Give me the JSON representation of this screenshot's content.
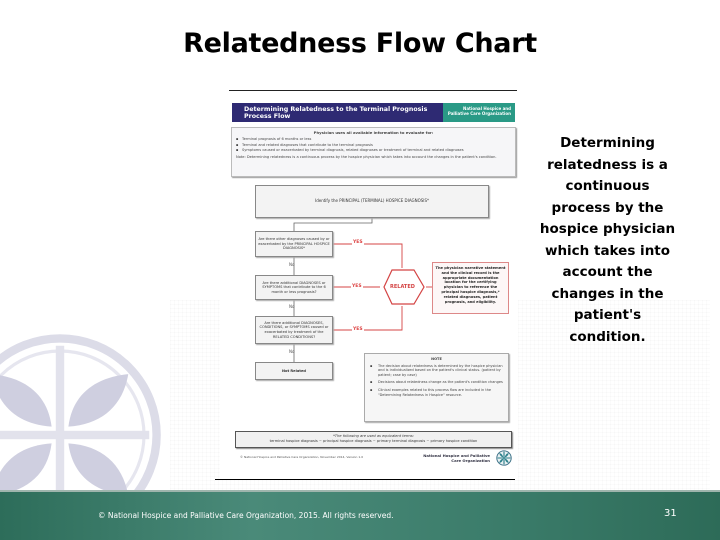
{
  "slide": {
    "title": "Relatedness Flow Chart",
    "side_text": "Determining relatedness is a continuous process by the hospice physician which takes into account the changes in the patient's condition.",
    "page_number": "31",
    "footer_copyright": "© National Hospice and Palliative Care Organization, 2015. All rights reserved."
  },
  "flowchart": {
    "header_title": "Determining Relatedness to the Terminal Prognosis Process Flow",
    "header_org": "National Hospice and Palliative Care Organization",
    "info": {
      "heading": "Physician uses all available information to evaluate for:",
      "items": [
        "Terminal prognosis of 6 months or less",
        "Terminal and related diagnoses that contribute to the terminal prognosis",
        "Symptoms caused or exacerbated by terminal diagnosis, related diagnoses or treatment of terminal and related diagnoses"
      ],
      "note": "Note: Determining relatedness is a continuous process by the hospice physician which takes into account the changes in the patient's condition."
    },
    "principal_step": "Identify the PRINCIPAL (TERMINAL) HOSPICE DIAGNOSIS*",
    "questions": [
      "Are there other diagnoses caused by or exacerbated by the PRINCIPAL HOSPICE DIAGNOSIS*",
      "Are there additional DIAGNOSES or SYMPTOMS that contribute to the 6 month or less prognosis?",
      "Are there additional DIAGNOSES, CONDITIONS, or SYMPTOMS caused or exacerbated by treatment of the RELATED CONDITIONS?"
    ],
    "no_label": "No",
    "yes_label": "YES",
    "related_label": "RELATED",
    "not_related_label": "Not Related",
    "explanation": "The physician narrative statement and the clinical record is the appropriate documentation location for the certifying physician to reference the principal hospice diagnosis,* related diagnoses, patient prognosis, and eligibility.",
    "note": {
      "heading": "NOTE",
      "items": [
        "The decision about relatedness is determined by the hospice physician and is individualized based on the patient's clinical status. (patient by patient; case by case)",
        "Decisions about relatedness change as the patient's condition changes",
        "Clinical examples related to this process flow are included in the \"Determining Relatedness in Hospice\" resource."
      ]
    },
    "equivalent": {
      "heading": "*The following are used as equivalent terms:",
      "terms": "terminal hospice diagnosis ~ principal hospice diagnosis ~ primary terminal diagnosis ~ primary hospice condition"
    },
    "copyright": "© National Hospice and Palliative Care Organization, November 2014, Version 1.0",
    "footer_org": "National Hospice and Palliative Care Organization"
  },
  "colors": {
    "header_navy": "#2e2a73",
    "header_teal": "#2a9a86",
    "related_red": "#d44444",
    "footer_green": "#3b7c6a"
  }
}
